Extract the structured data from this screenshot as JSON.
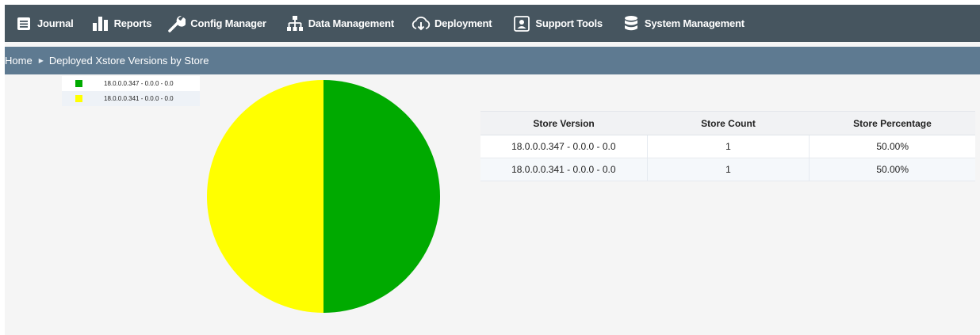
{
  "nav": {
    "items": [
      {
        "label": "Journal",
        "icon": "journal-icon"
      },
      {
        "label": "Reports",
        "icon": "reports-icon"
      },
      {
        "label": "Config Manager",
        "icon": "wrench-icon"
      },
      {
        "label": "Data Management",
        "icon": "sitemap-icon"
      },
      {
        "label": "Deployment",
        "icon": "cloud-download-icon"
      },
      {
        "label": "Support Tools",
        "icon": "support-icon"
      },
      {
        "label": "System Management",
        "icon": "database-icon"
      }
    ]
  },
  "breadcrumb": {
    "home": "Home",
    "current": "Deployed Xstore Versions by Store"
  },
  "chart_data": {
    "type": "pie",
    "legend_position": "top-left",
    "slices": [
      {
        "label": "18.0.0.0.347 - 0.0.0 - 0.0",
        "value": 1,
        "color": "#00aa00"
      },
      {
        "label": "18.0.0.0.341 - 0.0.0 - 0.0",
        "value": 1,
        "color": "#ffff00"
      }
    ]
  },
  "table": {
    "headers": [
      "Store Version",
      "Store Count",
      "Store Percentage"
    ],
    "rows": [
      [
        "18.0.0.0.347 - 0.0.0 - 0.0",
        "1",
        "50.00%"
      ],
      [
        "18.0.0.0.341 - 0.0.0 - 0.0",
        "1",
        "50.00%"
      ]
    ]
  },
  "colors": {
    "nav_bg": "#46555f",
    "breadcrumb_bg": "#5e7a91",
    "content_bg": "#f5f5f5"
  }
}
